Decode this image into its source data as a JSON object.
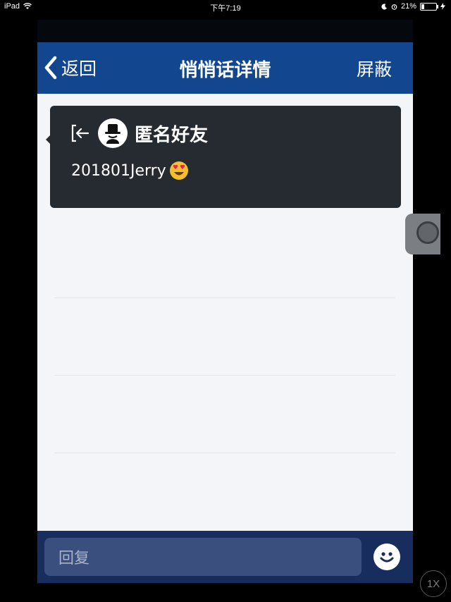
{
  "status_bar": {
    "device": "iPad",
    "time": "下午7:19",
    "battery": "21%",
    "battery_level": 0.21
  },
  "nav": {
    "back_label": "返回",
    "title": "悄悄话详情",
    "right_label": "屏蔽"
  },
  "message": {
    "sender": "匿名好友",
    "text": "201801Jerry",
    "icons": [
      "exit-icon",
      "anonymous-avatar-icon",
      "heart-eyes-emoji"
    ]
  },
  "footer": {
    "reply_placeholder": "回复",
    "emoji_button_icon": "smiley-icon"
  },
  "zoom_badge": "1X",
  "colors": {
    "navbar": "#12478f",
    "card": "#262b31",
    "footer": "#162d5e",
    "input": "#3b4f7f",
    "page": "#f4f5f8"
  }
}
